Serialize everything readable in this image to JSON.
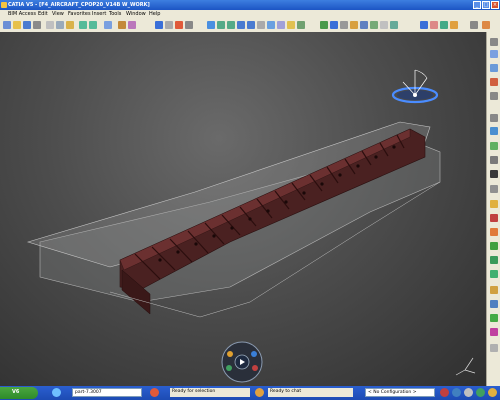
{
  "window": {
    "title": "CATIA V5 - [F4_AIRCRAFT_CPOP20_V14B     W_WORK]",
    "controls": {
      "minimize": "_",
      "maximize": "□",
      "close": "×"
    }
  },
  "menubar": {
    "items": [
      "BIM Access",
      "Edit",
      "View",
      "Favorites",
      "Insert",
      "Tools",
      "Window",
      "Help"
    ]
  },
  "statusbar": {
    "start_label": "V6",
    "command_value": "part-7.3007",
    "status_text": "Ready for selection",
    "chat_text": "Ready to chat",
    "config_text": "< No Configuration >"
  },
  "colors": {
    "titlebar": "#245edb",
    "chrome": "#ece9d8",
    "rib": "#5a2a2a",
    "skin": "#8a8a8a"
  }
}
